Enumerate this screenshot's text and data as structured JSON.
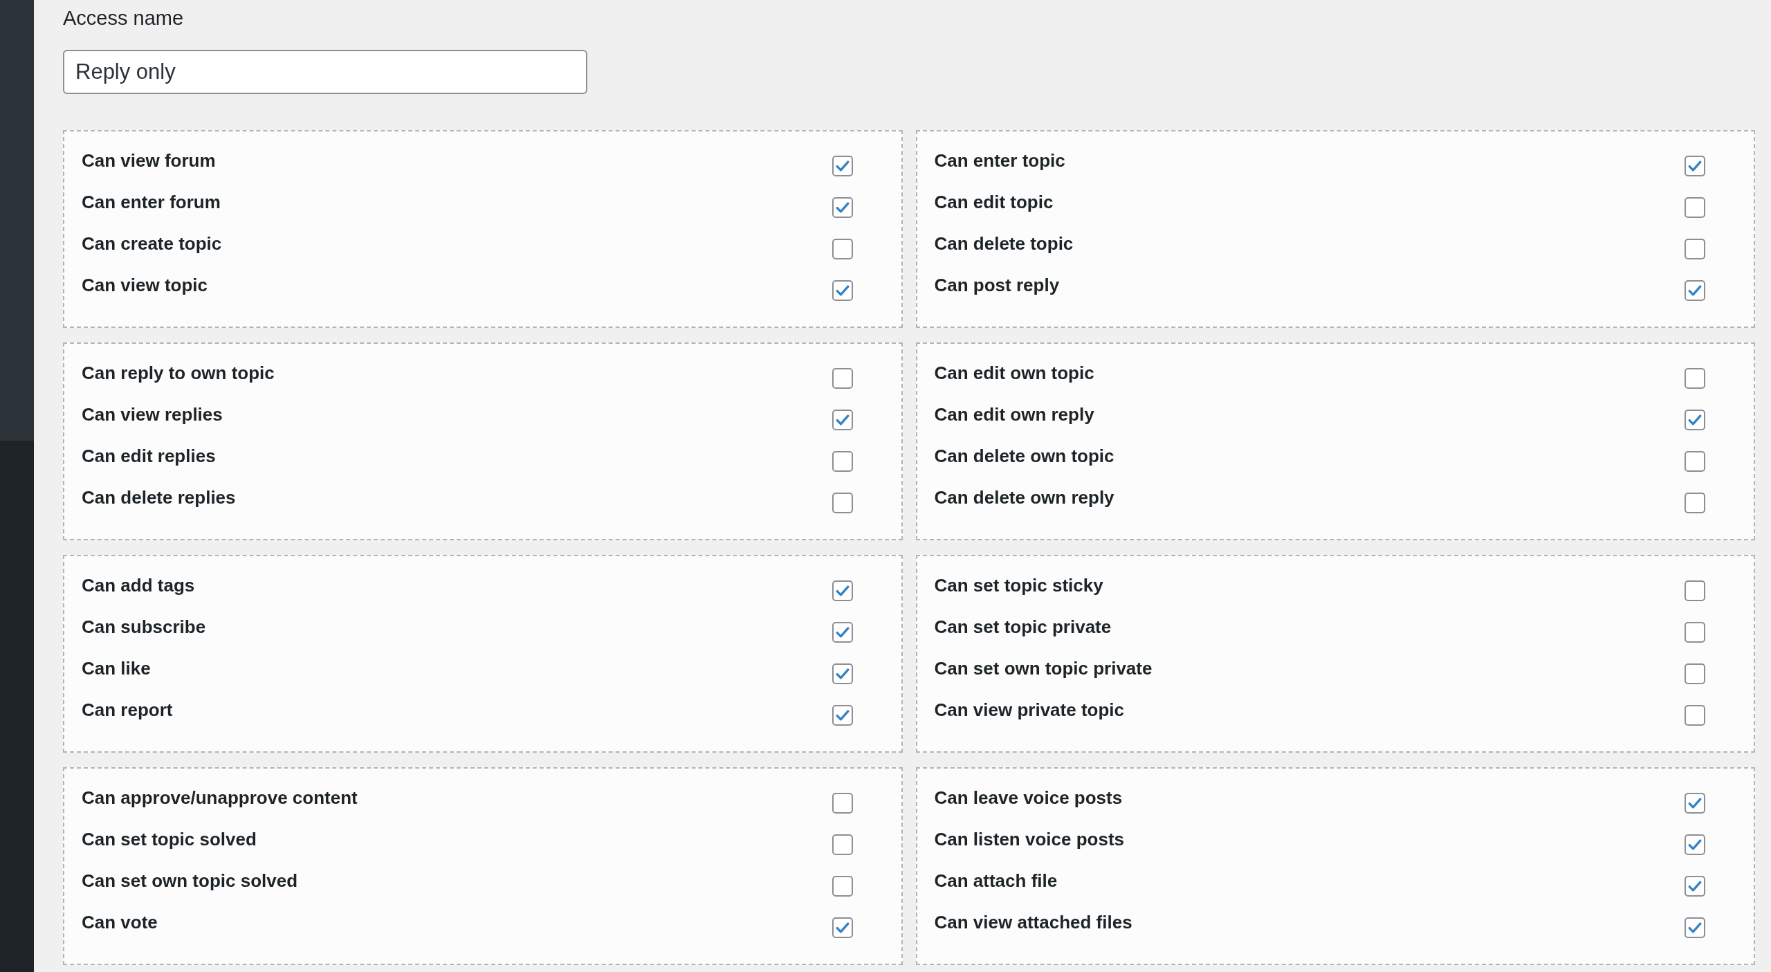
{
  "access_name": {
    "label": "Access name",
    "value": "Reply only"
  },
  "panels": [
    {
      "items": [
        {
          "label": "Can view forum",
          "checked": true
        },
        {
          "label": "Can enter forum",
          "checked": true
        },
        {
          "label": "Can create topic",
          "checked": false
        },
        {
          "label": "Can view topic",
          "checked": true
        }
      ]
    },
    {
      "items": [
        {
          "label": "Can enter topic",
          "checked": true
        },
        {
          "label": "Can edit topic",
          "checked": false
        },
        {
          "label": "Can delete topic",
          "checked": false
        },
        {
          "label": "Can post reply",
          "checked": true
        }
      ]
    },
    {
      "items": [
        {
          "label": "Can reply to own topic",
          "checked": false
        },
        {
          "label": "Can view replies",
          "checked": true
        },
        {
          "label": "Can edit replies",
          "checked": false
        },
        {
          "label": "Can delete replies",
          "checked": false
        }
      ]
    },
    {
      "items": [
        {
          "label": "Can edit own topic",
          "checked": false
        },
        {
          "label": "Can edit own reply",
          "checked": true
        },
        {
          "label": "Can delete own topic",
          "checked": false
        },
        {
          "label": "Can delete own reply",
          "checked": false
        }
      ]
    },
    {
      "items": [
        {
          "label": "Can add tags",
          "checked": true
        },
        {
          "label": "Can subscribe",
          "checked": true
        },
        {
          "label": "Can like",
          "checked": true
        },
        {
          "label": "Can report",
          "checked": true
        }
      ]
    },
    {
      "items": [
        {
          "label": "Can set topic sticky",
          "checked": false
        },
        {
          "label": "Can set topic private",
          "checked": false
        },
        {
          "label": "Can set own topic private",
          "checked": false
        },
        {
          "label": "Can view private topic",
          "checked": false
        }
      ]
    },
    {
      "items": [
        {
          "label": "Can approve/unapprove content",
          "checked": false
        },
        {
          "label": "Can set topic solved",
          "checked": false
        },
        {
          "label": "Can set own topic solved",
          "checked": false
        },
        {
          "label": "Can vote",
          "checked": true
        }
      ]
    },
    {
      "items": [
        {
          "label": "Can leave voice posts",
          "checked": true
        },
        {
          "label": "Can listen voice posts",
          "checked": true
        },
        {
          "label": "Can attach file",
          "checked": true
        },
        {
          "label": "Can view attached files",
          "checked": true
        }
      ]
    }
  ]
}
